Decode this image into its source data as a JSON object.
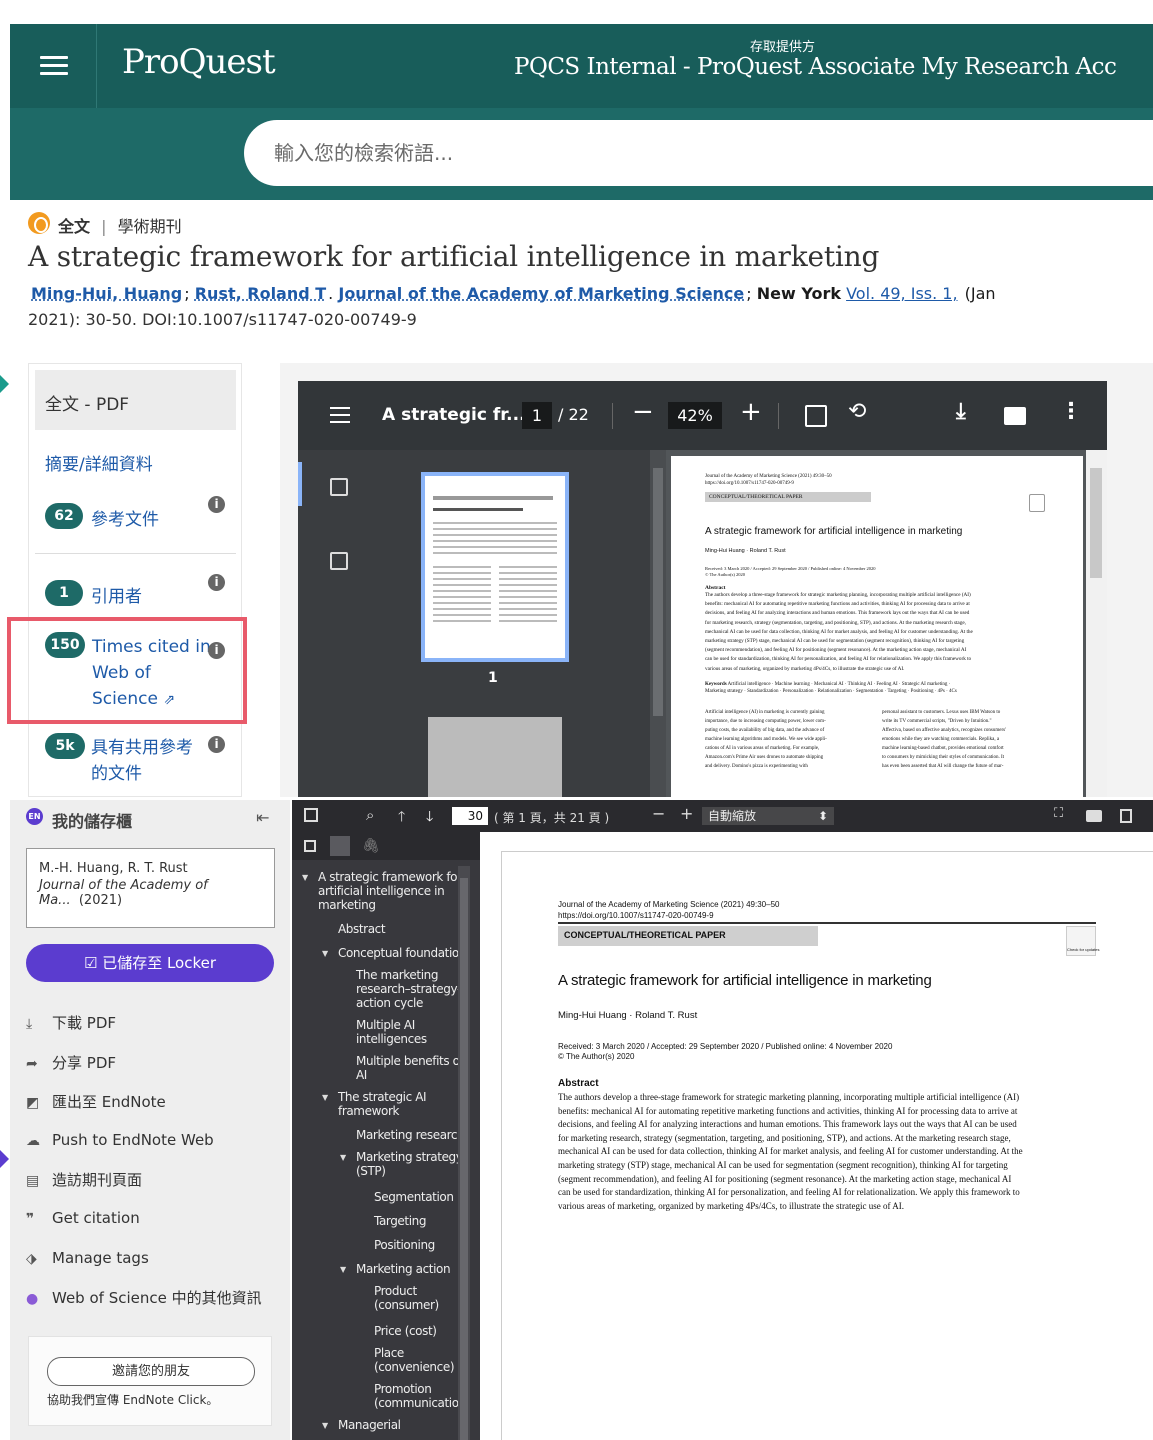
{
  "header": {
    "brand": "ProQuest",
    "provider_label": "存取提供方",
    "account": "PQCS Internal - ProQuest Associate My Research Acc",
    "search_placeholder": "輸入您的檢索術語..."
  },
  "record": {
    "fulltext_label": "全文",
    "separator": "|",
    "doc_type": "學術期刊",
    "title": "A strategic framework for artificial intelligence in marketing",
    "author1": "Ming-Hui, Huang",
    "author2": "Rust, Roland T",
    "journal": "Journal of the Academy of Marketing Science",
    "place": "New York",
    "volume": "Vol. 49, Iss. 1,",
    "date_open": "(Jan",
    "date_rest": "2021): 30-50. DOI:10.1007/s11747-020-00749-9"
  },
  "leftnav": {
    "fulltext_pdf": "全文 - PDF",
    "abstract": "摘要/詳細資料",
    "refs_count": "62",
    "refs_label": "參考文件",
    "cited_count": "1",
    "cited_label": "引用者",
    "wos_count": "150",
    "wos_line1": "Times cited in",
    "wos_line2": "Web of",
    "wos_line3": "Science",
    "shared_count": "5k",
    "shared_line1": "具有共用參考",
    "shared_line2": "的文件"
  },
  "pdfviewer": {
    "title": "A strategic fr...",
    "page_current": "1",
    "page_total": "/ 22",
    "zoom": "42%",
    "thumb_page": "1",
    "page": {
      "journal": "Journal of the Academy of Marketing Science (2021) 49:30–50",
      "doi": "https://doi.org/10.1007/s11747-020-00749-9",
      "section": "CONCEPTUAL/THEORETICAL PAPER",
      "title": "A strategic framework for artificial intelligence in marketing",
      "authors": "Ming-Hui Huang · Roland T. Rust",
      "received": "Received: 3 March 2020 / Accepted: 29 September 2020 / Published online: 4 November 2020",
      "copyright": "© The Author(s) 2020",
      "abstract_head": "Abstract",
      "abstract": [
        "The authors develop a three-stage framework for strategic marketing planning, incorporating multiple artificial intelligence (AI)",
        "benefits: mechanical AI for automating repetitive marketing functions and activities, thinking AI for processing data to arrive at",
        "decisions, and feeling AI for analyzing interactions and human emotions. This framework lays out the ways that AI can be used",
        "for marketing research, strategy (segmentation, targeting, and positioning, STP), and actions. At the marketing research stage,",
        "mechanical AI can be used for data collection, thinking AI for market analysis, and feeling AI for customer understanding. At the",
        "marketing strategy (STP) stage, mechanical AI can be used for segmentation (segment recognition), thinking AI for targeting",
        "(segment recommendation), and feeling AI for positioning (segment resonance). At the marketing action stage, mechanical AI",
        "can be used for standardization, thinking AI for personalization, and feeling AI for relationalization. We apply this framework to",
        "various areas of marketing, organized by marketing 4Ps/4Cs, to illustrate the strategic use of AI."
      ],
      "keywords_head": "Keywords",
      "keywords": "Artificial intelligence · Machine learning · Mechanical AI · Thinking AI · Feeling AI · Strategic AI marketing ·",
      "keywords2": "Marketing strategy · Standardization · Personalization · Relationalization · Segmentation · Targeting · Positioning · 4Ps · 4Cs",
      "col_left": [
        "Artificial intelligence (AI) in marketing is currently gaining",
        "importance, due to increasing computing power, lower com-",
        "puting costs, the availability of big data, and the advance of",
        "machine learning algorithms and models. We see wide appli-",
        "cations of AI in various areas of marketing. For example,",
        "Amazon.com's Prime Air uses drones to automate shipping",
        "and delivery. Domino's pizza is experimenting with"
      ],
      "col_right": [
        "personal assistant to customers. Lexus uses IBM Watson to",
        "write its TV commercial scripts, \"Driven by Intuition.\"",
        "Affectiva, based on affective analytics, recognizes consumers'",
        "emotions while they are watching commercials. Replika, a",
        "machine learning-based chatbot, provides emotional comfort",
        "to consumers by mimicking their styles of communication. It",
        "has even been asserted that AI will change the future of mar-"
      ]
    }
  },
  "locker": {
    "en_badge": "EN",
    "title": "我的儲存櫃",
    "card_authors": "M.-H. Huang, R. T. Rust",
    "card_journal": "Journal of the Academy of Ma...",
    "card_year": "(2021)",
    "saved_button": "已儲存至 Locker",
    "items": [
      "下載 PDF",
      "分享 PDF",
      "匯出至 EndNote",
      "Push to EndNote Web",
      "造訪期刊頁面",
      "Get citation",
      "Manage tags",
      "Web of Science 中的其他資訊"
    ],
    "invite_button": "邀請您的朋友",
    "invite_text": "協助我們宣傳 EndNote Click。"
  },
  "pdfjs": {
    "page_number": "30",
    "page_info": "( 第 1 頁，共 21 頁 )",
    "zoom_select": "自動縮放",
    "outline": [
      "A strategic framework for",
      "artificial intelligence in",
      "marketing",
      "Abstract",
      "Conceptual foundation",
      "The marketing",
      "research–strategy–",
      "action cycle",
      "Multiple AI",
      "intelligences",
      "Multiple benefits of",
      "AI",
      "The strategic AI",
      "framework",
      "Marketing research",
      "Marketing strategy",
      "(STP)",
      "Segmentation",
      "Targeting",
      "Positioning",
      "Marketing action",
      "Product",
      "(consumer)",
      "Price (cost)",
      "Place",
      "(convenience)",
      "Promotion",
      "(communication",
      "Managerial"
    ],
    "check_badge": "Check for updates"
  },
  "colors": {
    "header_bg": "#1e6a67",
    "link": "#1e5aa8",
    "accent_purple": "#5b3ccf",
    "highlight_red": "#e85a6a",
    "pill": "#1e6a67"
  }
}
